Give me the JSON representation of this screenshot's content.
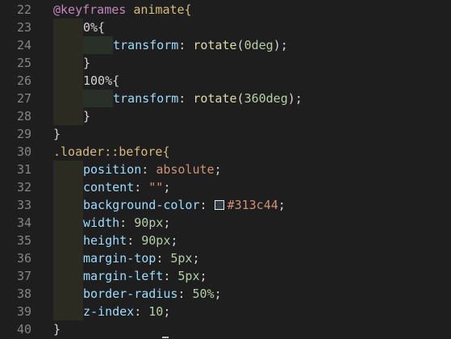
{
  "colors": {
    "background": "#1e1e1e",
    "line_number": "#858585",
    "default": "#d4d4d4",
    "keyword": "#c586c0",
    "selector": "#d7ba7d",
    "property": "#9cdcfe",
    "value_keyword": "#ce9178",
    "number": "#b5cea8",
    "function": "#dcdcaa",
    "punctuation": "#d4d4d4"
  },
  "swatch_color": "#313c44",
  "lines": [
    {
      "n": "22",
      "guides": 0,
      "tokens": [
        {
          "t": "@keyframes",
          "c": "keyword"
        },
        {
          "t": " animate{",
          "c": "selector"
        }
      ]
    },
    {
      "n": "23",
      "guides": 1,
      "tokens": [
        {
          "t": "0%{",
          "c": "default"
        }
      ]
    },
    {
      "n": "24",
      "guides": 2,
      "tokens": [
        {
          "t": "transform",
          "c": "property"
        },
        {
          "t": ": ",
          "c": "default"
        },
        {
          "t": "rotate",
          "c": "function"
        },
        {
          "t": "(",
          "c": "default"
        },
        {
          "t": "0deg",
          "c": "number"
        },
        {
          "t": ");",
          "c": "default"
        }
      ]
    },
    {
      "n": "25",
      "guides": 1,
      "tokens": [
        {
          "t": "}",
          "c": "default"
        }
      ]
    },
    {
      "n": "26",
      "guides": 1,
      "tokens": [
        {
          "t": "100%{",
          "c": "default"
        }
      ]
    },
    {
      "n": "27",
      "guides": 2,
      "tokens": [
        {
          "t": "transform",
          "c": "property"
        },
        {
          "t": ": ",
          "c": "default"
        },
        {
          "t": "rotate",
          "c": "function"
        },
        {
          "t": "(",
          "c": "default"
        },
        {
          "t": "360deg",
          "c": "number"
        },
        {
          "t": ");",
          "c": "default"
        }
      ]
    },
    {
      "n": "28",
      "guides": 1,
      "tokens": [
        {
          "t": "}",
          "c": "default"
        }
      ]
    },
    {
      "n": "29",
      "guides": 0,
      "tokens": [
        {
          "t": "}",
          "c": "default"
        }
      ]
    },
    {
      "n": "30",
      "guides": 0,
      "tokens": [
        {
          "t": ".loader::before{",
          "c": "selector"
        }
      ]
    },
    {
      "n": "31",
      "guides": 1,
      "tokens": [
        {
          "t": "position",
          "c": "property"
        },
        {
          "t": ": ",
          "c": "default"
        },
        {
          "t": "absolute",
          "c": "value_keyword"
        },
        {
          "t": ";",
          "c": "default"
        }
      ]
    },
    {
      "n": "32",
      "guides": 1,
      "tokens": [
        {
          "t": "content",
          "c": "property"
        },
        {
          "t": ": ",
          "c": "default"
        },
        {
          "t": "\"\"",
          "c": "value_keyword"
        },
        {
          "t": ";",
          "c": "default"
        }
      ]
    },
    {
      "n": "33",
      "guides": 1,
      "swatch": true,
      "tokens": [
        {
          "t": "background-color",
          "c": "property"
        },
        {
          "t": ": ",
          "c": "default"
        },
        {
          "t": "#313c44",
          "c": "value_keyword"
        },
        {
          "t": ";",
          "c": "default"
        }
      ]
    },
    {
      "n": "34",
      "guides": 1,
      "tokens": [
        {
          "t": "width",
          "c": "property"
        },
        {
          "t": ": ",
          "c": "default"
        },
        {
          "t": "90px",
          "c": "number"
        },
        {
          "t": ";",
          "c": "default"
        }
      ]
    },
    {
      "n": "35",
      "guides": 1,
      "tokens": [
        {
          "t": "height",
          "c": "property"
        },
        {
          "t": ": ",
          "c": "default"
        },
        {
          "t": "90px",
          "c": "number"
        },
        {
          "t": ";",
          "c": "default"
        }
      ]
    },
    {
      "n": "36",
      "guides": 1,
      "tokens": [
        {
          "t": "margin-top",
          "c": "property"
        },
        {
          "t": ": ",
          "c": "default"
        },
        {
          "t": "5px",
          "c": "number"
        },
        {
          "t": ";",
          "c": "default"
        }
      ]
    },
    {
      "n": "37",
      "guides": 1,
      "tokens": [
        {
          "t": "margin-left",
          "c": "property"
        },
        {
          "t": ": ",
          "c": "default"
        },
        {
          "t": "5px",
          "c": "number"
        },
        {
          "t": ";",
          "c": "default"
        }
      ]
    },
    {
      "n": "38",
      "guides": 1,
      "tokens": [
        {
          "t": "border-radius",
          "c": "property"
        },
        {
          "t": ": ",
          "c": "default"
        },
        {
          "t": "50%",
          "c": "number"
        },
        {
          "t": ";",
          "c": "default"
        }
      ]
    },
    {
      "n": "39",
      "guides": 1,
      "tokens": [
        {
          "t": "z-index",
          "c": "property"
        },
        {
          "t": ": ",
          "c": "default"
        },
        {
          "t": "10",
          "c": "number"
        },
        {
          "t": ";",
          "c": "default"
        }
      ]
    },
    {
      "n": "40",
      "guides": 0,
      "tokens": [
        {
          "t": "}",
          "c": "default"
        }
      ]
    }
  ]
}
